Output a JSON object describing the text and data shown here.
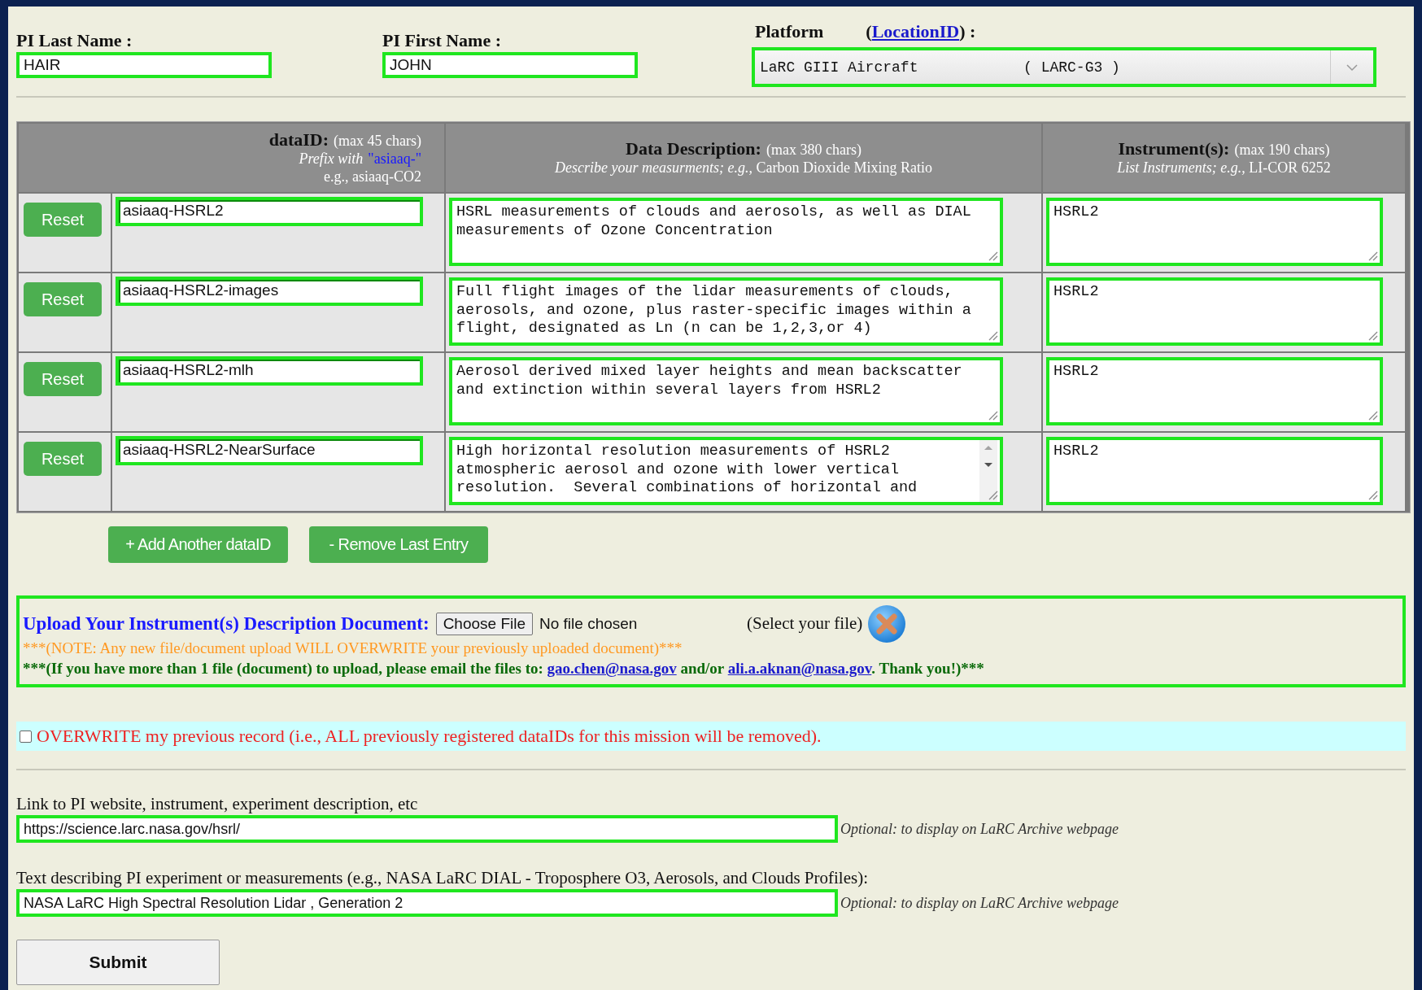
{
  "pi_last_name": {
    "label": "PI Last Name :",
    "value": "HAIR"
  },
  "pi_first_name": {
    "label": "PI First Name :",
    "value": "JOHN"
  },
  "platform": {
    "label": "Platform",
    "paren_open": "(",
    "link": "LocationID",
    "paren_close": ") :",
    "value": "LaRC GIII Aircraft            ( LARC-G3 )"
  },
  "table": {
    "columns": [
      {
        "title": "dataID:",
        "limit": "(max 45 chars)",
        "lines": [
          {
            "kind": "prefix",
            "text": "Prefix with",
            "code": "\"asiaaq-\""
          },
          {
            "kind": "plain",
            "text": "e.g., asiaaq-CO2"
          }
        ]
      },
      {
        "title": "Data Description:",
        "limit": "(max 380 chars)",
        "lines": [
          {
            "kind": "rich",
            "text": "*Describe your measurments; e.g.,* Carbon Dioxide Mixing Ratio"
          }
        ]
      },
      {
        "title": "Instrument(s):",
        "limit": "(max 190 chars)",
        "lines": [
          {
            "kind": "rich",
            "text": "*List Instruments; e.g.,* LI-COR 6252"
          }
        ]
      }
    ],
    "rows": [
      {
        "reset": "Reset",
        "data_id": "asiaaq-HSRL2",
        "description": "HSRL measurements of clouds and aerosols, as well as DIAL measurements of Ozone Concentration",
        "instruments": "HSRL2",
        "scrollbar": false
      },
      {
        "reset": "Reset",
        "data_id": "asiaaq-HSRL2-images",
        "description": "Full flight images of the lidar measurements of clouds, aerosols, and ozone, plus raster-specific images within a flight, designated as Ln (n can be 1,2,3,or 4)",
        "instruments": "HSRL2",
        "scrollbar": false
      },
      {
        "reset": "Reset",
        "data_id": "asiaaq-HSRL2-mlh",
        "description": "Aerosol derived mixed layer heights and mean backscatter and extinction within several layers from HSRL2",
        "instruments": "HSRL2",
        "scrollbar": false
      },
      {
        "reset": "Reset",
        "data_id": "asiaaq-HSRL2-NearSurface",
        "description": "High horizontal resolution measurements of HSRL2 atmospheric aerosol and ozone with lower vertical resolution.  Several combinations of horizontal and",
        "instruments": "HSRL2",
        "scrollbar": true
      }
    ]
  },
  "add_button": "+ Add Another dataID",
  "remove_button": "- Remove Last Entry",
  "upload": {
    "title": "Upload Your Instrument(s) Description Document:",
    "choose_button": "Choose File",
    "file_status": "No file chosen",
    "select_hint": "(Select your file)",
    "warning": "***(NOTE: Any new file/document upload WILL OVERWRITE your previously uploaded document)***",
    "email_note": [
      {
        "kind": "text",
        "text": "***(If you have more than 1 file (document) to upload, please email the files to: "
      },
      {
        "kind": "link",
        "text": "gao.chen@nasa.gov"
      },
      {
        "kind": "text",
        "text": " and/or "
      },
      {
        "kind": "link",
        "text": "ali.a.aknan@nasa.gov"
      },
      {
        "kind": "text",
        "text": ". Thank you!)***"
      }
    ]
  },
  "overwrite": {
    "checked": false,
    "label": "OVERWRITE my previous record (i.e., ALL previously registered dataIDs for this mission will be removed)."
  },
  "optional_fields": [
    {
      "label": "Link to PI website, instrument, experiment description, etc",
      "value": "https://science.larc.nasa.gov/hsrl/",
      "hint": "Optional: to display on LaRC Archive webpage"
    },
    {
      "label": "Text describing PI experiment or measurements (e.g., NASA LaRC DIAL - Troposphere O3, Aerosols, and Clouds Profiles):",
      "value": "NASA LaRC High Spectral Resolution Lidar , Generation 2",
      "hint": "Optional: to display on LaRC Archive webpage"
    }
  ],
  "submit": "Submit"
}
